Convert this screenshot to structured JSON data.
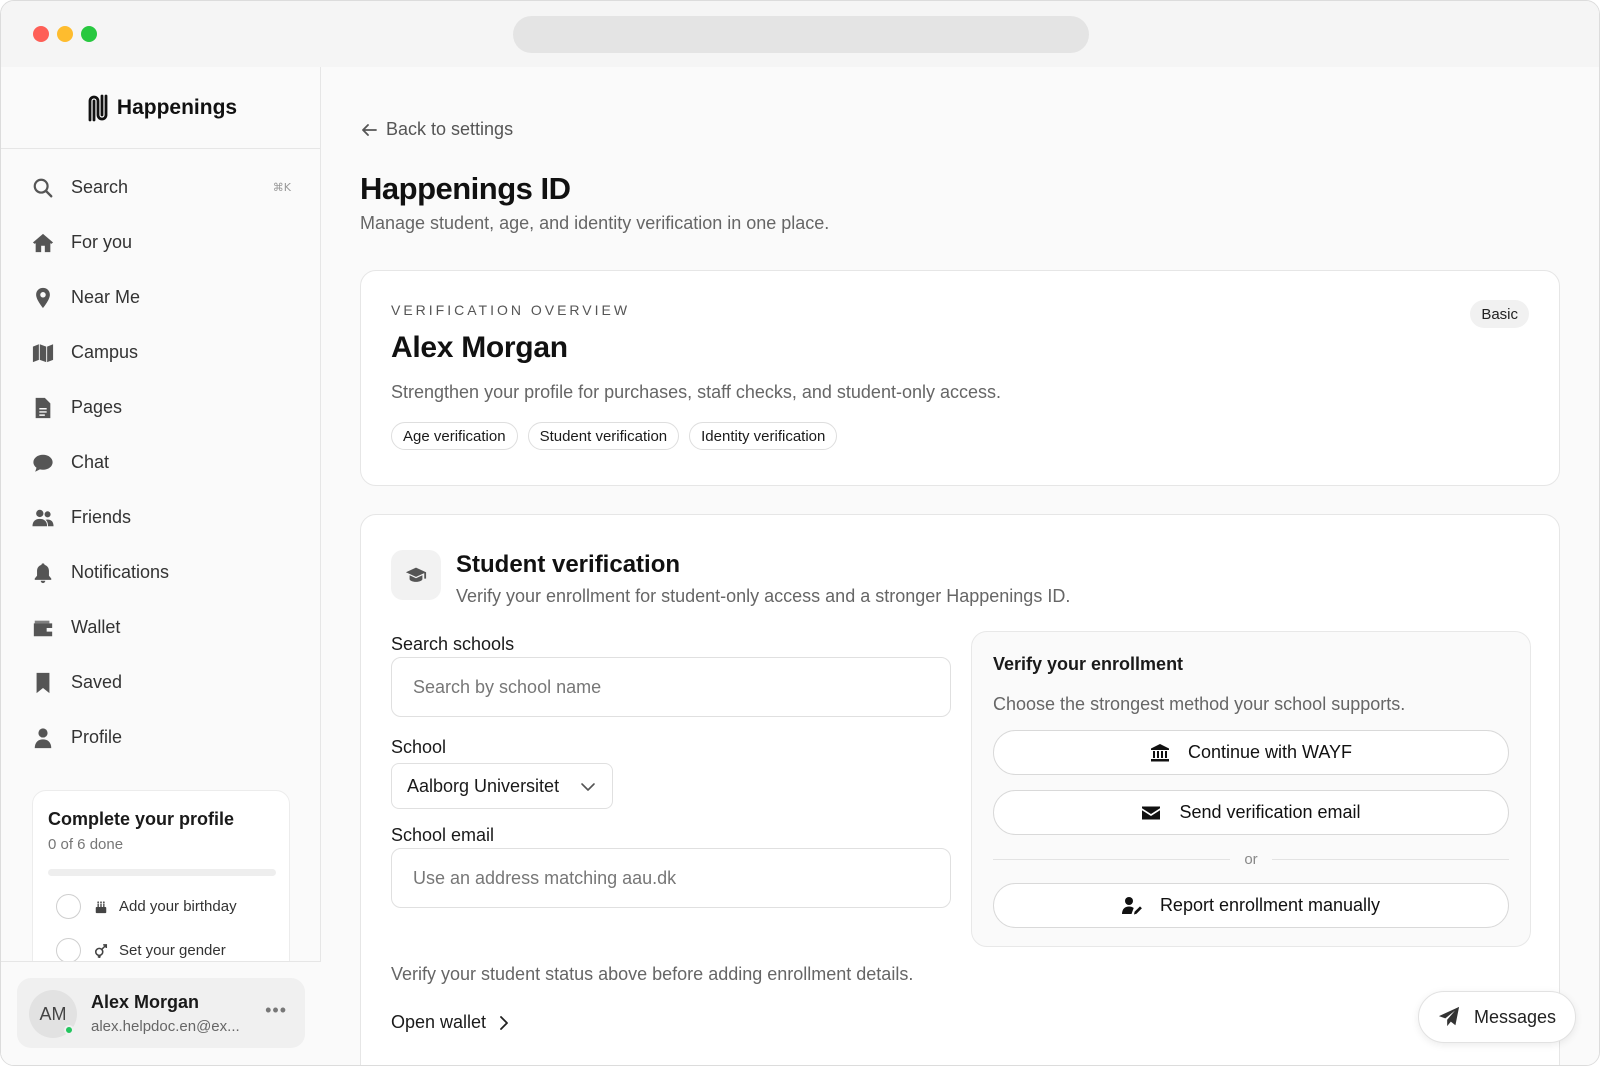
{
  "brand": {
    "name": "Happenings"
  },
  "sidebar": {
    "search": {
      "label": "Search",
      "shortcut": "⌘K"
    },
    "items": [
      {
        "label": "For you",
        "icon": "home-icon"
      },
      {
        "label": "Near Me",
        "icon": "map-pin-icon"
      },
      {
        "label": "Campus",
        "icon": "map-icon"
      },
      {
        "label": "Pages",
        "icon": "document-icon"
      },
      {
        "label": "Chat",
        "icon": "chat-bubble-icon"
      },
      {
        "label": "Friends",
        "icon": "users-icon"
      },
      {
        "label": "Notifications",
        "icon": "bell-icon"
      },
      {
        "label": "Wallet",
        "icon": "wallet-icon"
      },
      {
        "label": "Saved",
        "icon": "bookmark-icon"
      },
      {
        "label": "Profile",
        "icon": "user-icon"
      }
    ],
    "profile_card": {
      "title": "Complete your profile",
      "progress": "0 of 6 done",
      "progress_fraction": 0,
      "tasks": [
        {
          "label": "Add your birthday",
          "icon": "cake-icon"
        },
        {
          "label": "Set your gender",
          "icon": "gender-icon"
        }
      ]
    },
    "user": {
      "initials": "AM",
      "name": "Alex Morgan",
      "email": "alex.helpdoc.en@ex..."
    }
  },
  "main": {
    "back_label": "Back to settings",
    "title": "Happenings ID",
    "subtitle": "Manage student, age, and identity verification in one place.",
    "overview": {
      "eyebrow": "VERIFICATION OVERVIEW",
      "name": "Alex Morgan",
      "description": "Strengthen your profile for purchases, staff checks, and student-only access.",
      "badge": "Basic",
      "chips": [
        "Age verification",
        "Student verification",
        "Identity verification"
      ]
    },
    "student": {
      "title": "Student verification",
      "description": "Verify your enrollment for student-only access and a stronger Happenings ID.",
      "search_label": "Search schools",
      "search_placeholder": "Search by school name",
      "school_label": "School",
      "school_value": "Aalborg Universitet",
      "email_label": "School email",
      "email_placeholder": "Use an address matching aau.dk",
      "enroll": {
        "title": "Verify your enrollment",
        "description": "Choose the strongest method your school supports.",
        "wayf_label": "Continue with WAYF",
        "email_label": "Send verification email",
        "or": "or",
        "manual_label": "Report enrollment manually"
      },
      "note": "Verify your student status above before adding enrollment details.",
      "wallet_label": "Open wallet"
    }
  },
  "messages": {
    "label": "Messages"
  }
}
